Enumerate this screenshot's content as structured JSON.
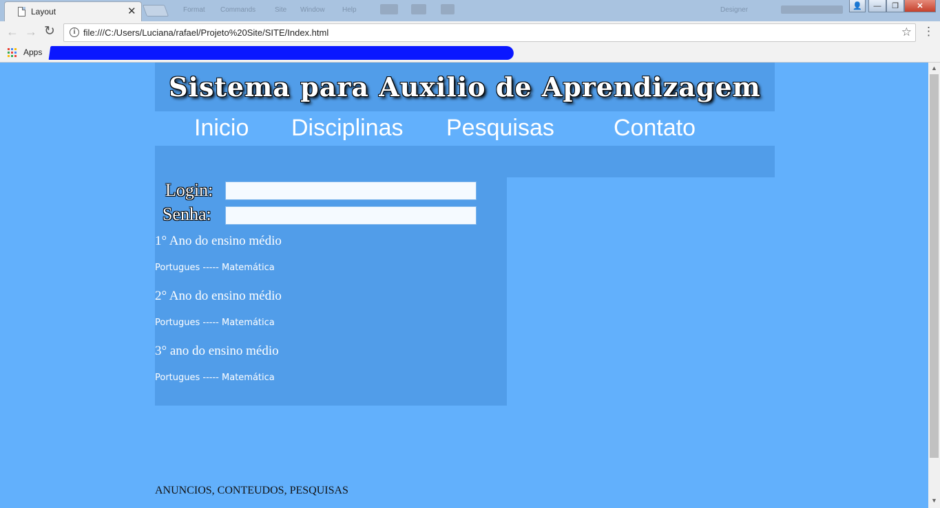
{
  "browser": {
    "tab_title": "Layout",
    "tab_close": "✕",
    "ghost_menus": [
      "Format",
      "Commands",
      "Site",
      "Window",
      "Help"
    ],
    "ghost_right": "Designer",
    "window_buttons": [
      "👤",
      "—",
      "❐",
      "✕"
    ],
    "back_icon": "arrow-left-icon",
    "forward_icon": "arrow-right-icon",
    "reload_icon": "reload-icon",
    "url": "file:///C:/Users/Luciana/rafael/Projeto%20Site/SITE/Index.html",
    "bookmarks_apps_label": "Apps"
  },
  "page": {
    "title": "Sistema para Auxilio de Aprendizagem",
    "nav": [
      "Inicio",
      "Disciplinas",
      "Pesquisas",
      "Contato"
    ],
    "login_label": "Login:",
    "password_label": "Senha:",
    "login_value": "",
    "password_value": "",
    "sections": [
      {
        "heading": "1° Ano do ensino médio",
        "subjects": [
          "Portugues",
          "Matemática"
        ],
        "separator": " ----- "
      },
      {
        "heading": "2° Ano do ensino médio",
        "subjects": [
          "Portugues",
          "Matemática"
        ],
        "separator": " ----- "
      },
      {
        "heading": "3° ano do ensino médio",
        "subjects": [
          "Portugues",
          "Matemática"
        ],
        "separator": " ----- "
      }
    ],
    "footer": "ANUNCIOS, CONTEUDOS, PESQUISAS"
  },
  "colors": {
    "page_background": "#62b0fc",
    "panel": "#519de9",
    "text": "#ffffff",
    "redaction": "#0a17ff"
  }
}
